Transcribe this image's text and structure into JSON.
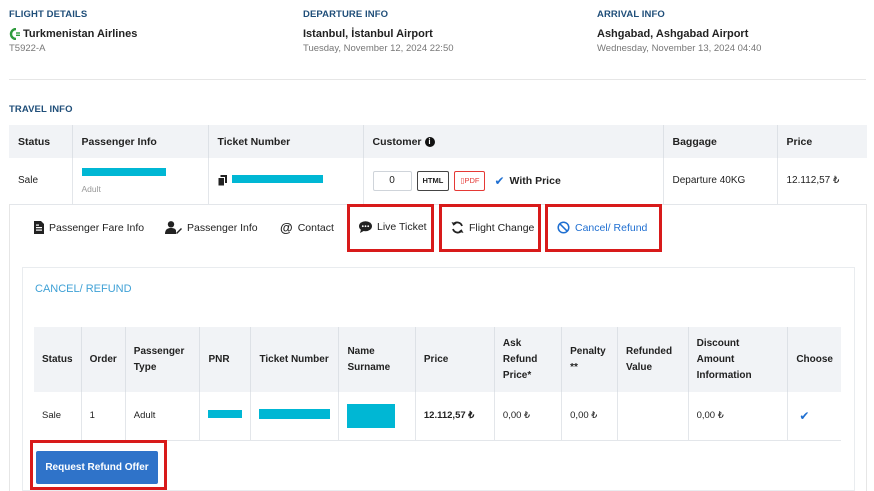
{
  "flight_details": {
    "label": "FLIGHT DETAILS",
    "airline": "Turkmenistan Airlines",
    "flight_no": "T5922-A"
  },
  "departure_info": {
    "label": "DEPARTURE INFO",
    "airport": "Istanbul, İstanbul Airport",
    "datetime": "Tuesday, November 12, 2024 22:50"
  },
  "arrival_info": {
    "label": "ARRIVAL INFO",
    "airport": "Ashgabad, Ashgabad Airport",
    "datetime": "Wednesday, November 13, 2024 04:40"
  },
  "travel_info": {
    "label": "TRAVEL INFO",
    "headers": {
      "status": "Status",
      "passenger_info": "Passenger Info",
      "ticket_number": "Ticket Number",
      "customer": "Customer",
      "baggage": "Baggage",
      "price": "Price"
    },
    "row": {
      "status": "Sale",
      "passenger_type": "Adult",
      "customer_count": "0",
      "html_label": "HTML",
      "pdf_label": "PDF",
      "with_price_label": "With Price",
      "baggage": "Departure 40KG",
      "price": "12.112,57 ₺"
    }
  },
  "tabs": [
    {
      "label": "Passenger Fare Info",
      "icon": "receipt-icon"
    },
    {
      "label": "Passenger Info",
      "icon": "user-edit-icon"
    },
    {
      "label": "Contact",
      "icon": "at-icon"
    },
    {
      "label": "Live Ticket",
      "icon": "chat-icon"
    },
    {
      "label": "Flight Change",
      "icon": "sync-icon"
    },
    {
      "label": "Cancel/ Refund",
      "icon": "ban-icon"
    }
  ],
  "cancel_refund": {
    "title": "CANCEL/ REFUND",
    "headers": {
      "status": "Status",
      "order": "Order",
      "passenger_type": "Passenger Type",
      "pnr": "PNR",
      "ticket_number": "Ticket Number",
      "name_surname": "Name Surname",
      "price": "Price",
      "ask_refund_price": "Ask Refund Price*",
      "penalty": "Penalty **",
      "refunded_value": "Refunded Value",
      "discount_amount": "Discount Amount Information",
      "choose": "Choose"
    },
    "row": {
      "status": "Sale",
      "order": "1",
      "passenger_type": "Adult",
      "price": "12.112,57 ₺",
      "ask_refund_price": "0,00 ₺",
      "penalty": "0,00 ₺",
      "refunded_value": "",
      "discount_amount": "0,00 ₺"
    },
    "request_button": "Request Refund Offer"
  },
  "colors": {
    "accent_blue": "#1f6fd1",
    "section_label": "#1f4e79",
    "redaction": "#00b7d4",
    "highlight_red": "#d81a1a",
    "button_blue": "#2f73c9"
  }
}
